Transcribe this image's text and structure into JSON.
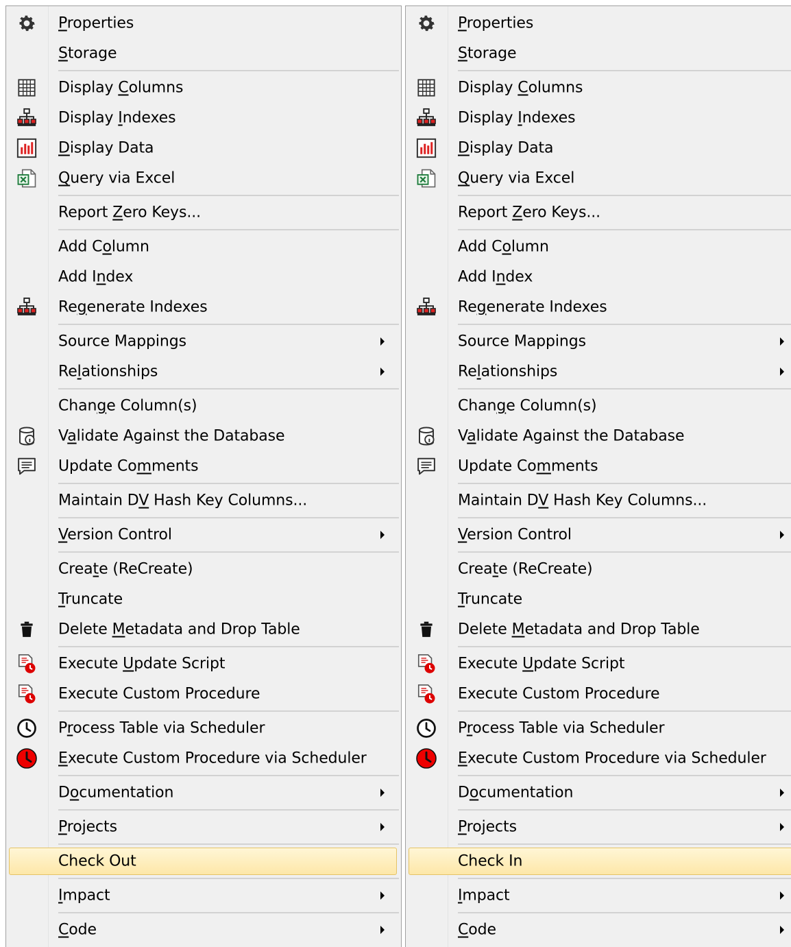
{
  "menus": [
    {
      "id": "left",
      "items": [
        {
          "type": "item",
          "icon": "gear-icon",
          "pre": "",
          "u": "P",
          "post": "roperties"
        },
        {
          "type": "item",
          "icon": "",
          "pre": "",
          "u": "S",
          "post": "torage"
        },
        {
          "type": "sep"
        },
        {
          "type": "item",
          "icon": "grid-icon",
          "pre": "Display ",
          "u": "C",
          "post": "olumns"
        },
        {
          "type": "item",
          "icon": "hierarchy-icon",
          "pre": "Display ",
          "u": "I",
          "post": "ndexes"
        },
        {
          "type": "item",
          "icon": "bar-chart-icon",
          "pre": "",
          "u": "D",
          "post": "isplay Data"
        },
        {
          "type": "item",
          "icon": "excel-icon",
          "pre": "",
          "u": "Q",
          "post": "uery via Excel"
        },
        {
          "type": "sep"
        },
        {
          "type": "item",
          "icon": "",
          "pre": "Report ",
          "u": "Z",
          "post": "ero Keys..."
        },
        {
          "type": "sep"
        },
        {
          "type": "item",
          "icon": "",
          "pre": "Add C",
          "u": "o",
          "post": "lumn"
        },
        {
          "type": "item",
          "icon": "",
          "pre": "Add I",
          "u": "n",
          "post": "dex"
        },
        {
          "type": "item",
          "icon": "hierarchy-icon",
          "pre": "Re",
          "u": "g",
          "post": "enerate Indexes"
        },
        {
          "type": "sep"
        },
        {
          "type": "item",
          "icon": "",
          "pre": "Source Mappings",
          "u": "",
          "post": "",
          "sub": true
        },
        {
          "type": "item",
          "icon": "",
          "pre": "Re",
          "u": "l",
          "post": "ationships",
          "sub": true
        },
        {
          "type": "sep"
        },
        {
          "type": "item",
          "icon": "",
          "pre": "Chan",
          "u": "g",
          "post": "e Column(s)"
        },
        {
          "type": "item",
          "icon": "database-info-icon",
          "pre": "V",
          "u": "a",
          "post": "lidate Against the Database"
        },
        {
          "type": "item",
          "icon": "comment-icon",
          "pre": "Update Co",
          "u": "m",
          "post": "ments"
        },
        {
          "type": "sep"
        },
        {
          "type": "item",
          "icon": "",
          "pre": "Maintain D",
          "u": "V",
          "post": " Hash Key Columns..."
        },
        {
          "type": "sep"
        },
        {
          "type": "item",
          "icon": "",
          "pre": "",
          "u": "V",
          "post": "ersion Control",
          "sub": true
        },
        {
          "type": "sep"
        },
        {
          "type": "item",
          "icon": "",
          "pre": "Crea",
          "u": "t",
          "post": "e (ReCreate)"
        },
        {
          "type": "item",
          "icon": "",
          "pre": "",
          "u": "T",
          "post": "runcate"
        },
        {
          "type": "item",
          "icon": "trash-icon",
          "pre": "Delete ",
          "u": "M",
          "post": "etadata and Drop Table"
        },
        {
          "type": "sep"
        },
        {
          "type": "item",
          "icon": "script-icon",
          "pre": "Execute ",
          "u": "U",
          "post": "pdate Script"
        },
        {
          "type": "item",
          "icon": "script-icon",
          "pre": "Execute Custom Procedure",
          "u": "",
          "post": ""
        },
        {
          "type": "sep"
        },
        {
          "type": "item",
          "icon": "clock-icon",
          "pre": "P",
          "u": "r",
          "post": "ocess Table via Scheduler"
        },
        {
          "type": "item",
          "icon": "red-clock-icon",
          "pre": "",
          "u": "E",
          "post": "xecute Custom Procedure via Scheduler"
        },
        {
          "type": "sep"
        },
        {
          "type": "item",
          "icon": "",
          "pre": "D",
          "u": "o",
          "post": "cumentation",
          "sub": true
        },
        {
          "type": "sep"
        },
        {
          "type": "item",
          "icon": "",
          "pre": "",
          "u": "P",
          "post": "rojects",
          "sub": true
        },
        {
          "type": "sep"
        },
        {
          "type": "item",
          "icon": "",
          "pre": "Check Out",
          "u": "",
          "post": "",
          "highlight": true
        },
        {
          "type": "sep"
        },
        {
          "type": "item",
          "icon": "",
          "pre": "",
          "u": "I",
          "post": "mpact",
          "sub": true
        },
        {
          "type": "sep"
        },
        {
          "type": "item",
          "icon": "",
          "pre": "",
          "u": "C",
          "post": "ode",
          "sub": true
        }
      ]
    },
    {
      "id": "right",
      "items": [
        {
          "type": "item",
          "icon": "gear-icon",
          "pre": "",
          "u": "P",
          "post": "roperties"
        },
        {
          "type": "item",
          "icon": "",
          "pre": "",
          "u": "S",
          "post": "torage"
        },
        {
          "type": "sep"
        },
        {
          "type": "item",
          "icon": "grid-icon",
          "pre": "Display ",
          "u": "C",
          "post": "olumns"
        },
        {
          "type": "item",
          "icon": "hierarchy-icon",
          "pre": "Display ",
          "u": "I",
          "post": "ndexes"
        },
        {
          "type": "item",
          "icon": "bar-chart-icon",
          "pre": "",
          "u": "D",
          "post": "isplay Data"
        },
        {
          "type": "item",
          "icon": "excel-icon",
          "pre": "",
          "u": "Q",
          "post": "uery via Excel"
        },
        {
          "type": "sep"
        },
        {
          "type": "item",
          "icon": "",
          "pre": "Report ",
          "u": "Z",
          "post": "ero Keys..."
        },
        {
          "type": "sep"
        },
        {
          "type": "item",
          "icon": "",
          "pre": "Add C",
          "u": "o",
          "post": "lumn"
        },
        {
          "type": "item",
          "icon": "",
          "pre": "Add I",
          "u": "n",
          "post": "dex"
        },
        {
          "type": "item",
          "icon": "hierarchy-icon",
          "pre": "Re",
          "u": "g",
          "post": "enerate Indexes"
        },
        {
          "type": "sep"
        },
        {
          "type": "item",
          "icon": "",
          "pre": "Source Mappings",
          "u": "",
          "post": "",
          "sub": true
        },
        {
          "type": "item",
          "icon": "",
          "pre": "Re",
          "u": "l",
          "post": "ationships",
          "sub": true
        },
        {
          "type": "sep"
        },
        {
          "type": "item",
          "icon": "",
          "pre": "Chan",
          "u": "g",
          "post": "e Column(s)"
        },
        {
          "type": "item",
          "icon": "database-info-icon",
          "pre": "V",
          "u": "a",
          "post": "lidate Against the Database"
        },
        {
          "type": "item",
          "icon": "comment-icon",
          "pre": "Update Co",
          "u": "m",
          "post": "ments"
        },
        {
          "type": "sep"
        },
        {
          "type": "item",
          "icon": "",
          "pre": "Maintain D",
          "u": "V",
          "post": " Hash Key Columns..."
        },
        {
          "type": "sep"
        },
        {
          "type": "item",
          "icon": "",
          "pre": "",
          "u": "V",
          "post": "ersion Control",
          "sub": true
        },
        {
          "type": "sep"
        },
        {
          "type": "item",
          "icon": "",
          "pre": "Crea",
          "u": "t",
          "post": "e (ReCreate)"
        },
        {
          "type": "item",
          "icon": "",
          "pre": "",
          "u": "T",
          "post": "runcate"
        },
        {
          "type": "item",
          "icon": "trash-icon",
          "pre": "Delete ",
          "u": "M",
          "post": "etadata and Drop Table"
        },
        {
          "type": "sep"
        },
        {
          "type": "item",
          "icon": "script-icon",
          "pre": "Execute ",
          "u": "U",
          "post": "pdate Script"
        },
        {
          "type": "item",
          "icon": "script-icon",
          "pre": "Execute Custom Procedure",
          "u": "",
          "post": ""
        },
        {
          "type": "sep"
        },
        {
          "type": "item",
          "icon": "clock-icon",
          "pre": "P",
          "u": "r",
          "post": "ocess Table via Scheduler"
        },
        {
          "type": "item",
          "icon": "red-clock-icon",
          "pre": "",
          "u": "E",
          "post": "xecute Custom Procedure via Scheduler"
        },
        {
          "type": "sep"
        },
        {
          "type": "item",
          "icon": "",
          "pre": "D",
          "u": "o",
          "post": "cumentation",
          "sub": true
        },
        {
          "type": "sep"
        },
        {
          "type": "item",
          "icon": "",
          "pre": "",
          "u": "P",
          "post": "rojects",
          "sub": true
        },
        {
          "type": "sep"
        },
        {
          "type": "item",
          "icon": "",
          "pre": "Check In",
          "u": "",
          "post": "",
          "highlight": true
        },
        {
          "type": "sep"
        },
        {
          "type": "item",
          "icon": "",
          "pre": "",
          "u": "I",
          "post": "mpact",
          "sub": true
        },
        {
          "type": "sep"
        },
        {
          "type": "item",
          "icon": "",
          "pre": "",
          "u": "C",
          "post": "ode",
          "sub": true
        }
      ]
    }
  ]
}
